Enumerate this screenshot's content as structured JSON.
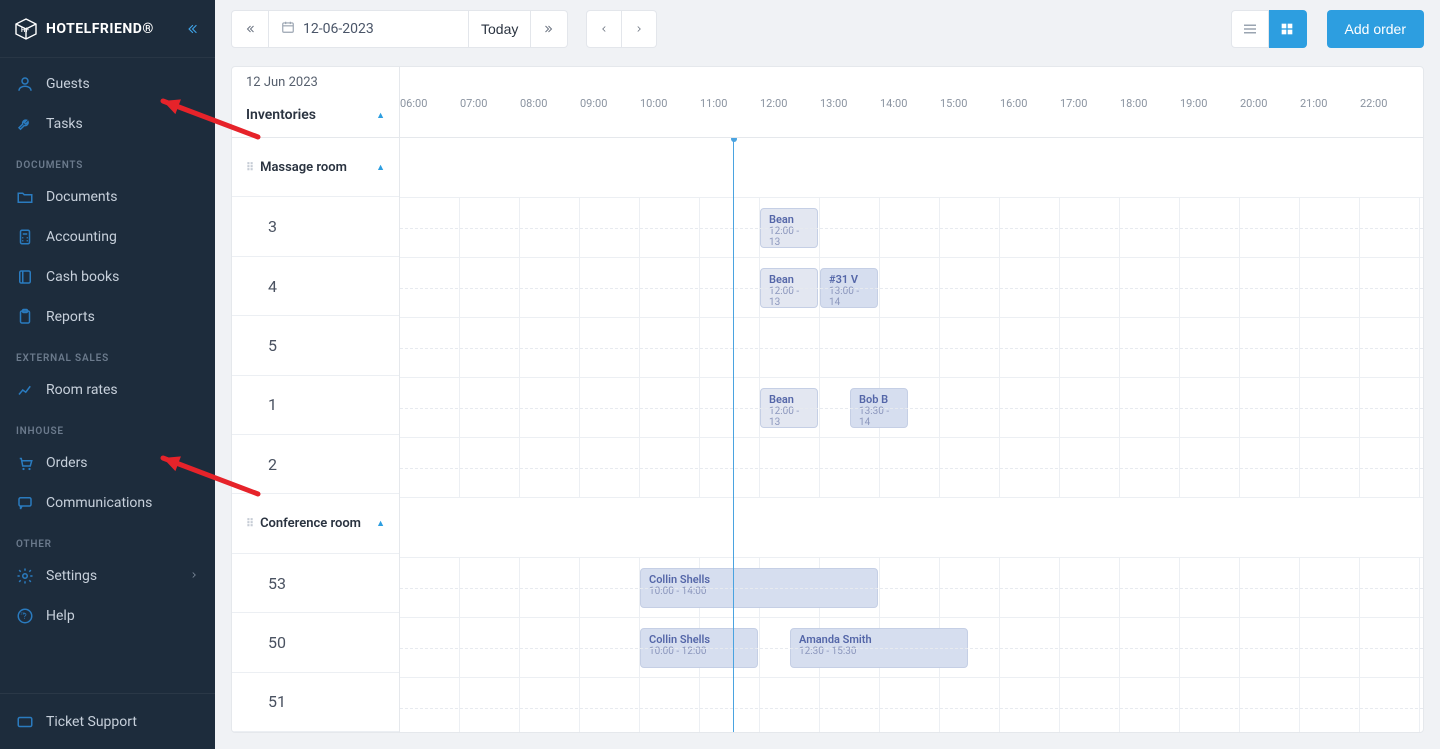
{
  "brand": {
    "name": "HOTELFRIEND",
    "trademark": "®"
  },
  "sidebar": {
    "items": [
      {
        "label": "Guests",
        "icon": "user-icon"
      },
      {
        "label": "Tasks",
        "icon": "wrench-icon"
      }
    ],
    "sections": [
      {
        "title": "DOCUMENTS",
        "items": [
          {
            "label": "Documents",
            "icon": "folder-icon"
          },
          {
            "label": "Accounting",
            "icon": "calculator-icon"
          },
          {
            "label": "Cash books",
            "icon": "book-icon"
          },
          {
            "label": "Reports",
            "icon": "clipboard-icon"
          }
        ]
      },
      {
        "title": "EXTERNAL SALES",
        "items": [
          {
            "label": "Room rates",
            "icon": "chart-icon"
          }
        ]
      },
      {
        "title": "INHOUSE",
        "items": [
          {
            "label": "Orders",
            "icon": "cart-icon"
          },
          {
            "label": "Communications",
            "icon": "chat-icon"
          }
        ]
      },
      {
        "title": "OTHER",
        "items": [
          {
            "label": "Settings",
            "icon": "gear-icon",
            "chevron": true
          },
          {
            "label": "Help",
            "icon": "help-icon"
          }
        ]
      }
    ],
    "footer": {
      "label": "Ticket Support",
      "icon": "ticket-icon"
    }
  },
  "toolbar": {
    "date": "12-06-2023",
    "today_label": "Today",
    "add_order_label": "Add order"
  },
  "scheduler": {
    "date_header": "12 Jun 2023",
    "inventories_label": "Inventories",
    "hours": [
      "06:00",
      "07:00",
      "08:00",
      "09:00",
      "10:00",
      "11:00",
      "12:00",
      "13:00",
      "14:00",
      "15:00",
      "16:00",
      "17:00",
      "18:00",
      "19:00",
      "20:00",
      "21:00",
      "22:00"
    ],
    "now_hour_fraction": 11.55,
    "groups": [
      {
        "name": "Massage room",
        "rows": [
          {
            "label": "3",
            "events": [
              {
                "name": "Bean",
                "time": "12:00 - 13",
                "start": 12,
                "end": 13,
                "light": true
              }
            ]
          },
          {
            "label": "4",
            "events": [
              {
                "name": "Bean",
                "time": "12:00 - 13",
                "start": 12,
                "end": 13,
                "light": true
              },
              {
                "name": "#31 V",
                "time": "13:00 - 14",
                "start": 13,
                "end": 14,
                "light": false
              }
            ]
          },
          {
            "label": "5",
            "events": []
          },
          {
            "label": "1",
            "events": [
              {
                "name": "Bean",
                "time": "12:00 - 13",
                "start": 12,
                "end": 13,
                "light": true
              },
              {
                "name": "Bob B",
                "time": "13:30 - 14",
                "start": 13.5,
                "end": 14.5,
                "light": false
              }
            ]
          },
          {
            "label": "2",
            "events": []
          }
        ]
      },
      {
        "name": "Conference room",
        "rows": [
          {
            "label": "53",
            "events": [
              {
                "name": "Collin Shells",
                "time": "10:00 - 14:00",
                "start": 10,
                "end": 14,
                "light": false
              }
            ]
          },
          {
            "label": "50",
            "events": [
              {
                "name": "Collin Shells",
                "time": "10:00 - 12:00",
                "start": 10,
                "end": 12,
                "light": false
              },
              {
                "name": "Amanda Smith",
                "time": "12:30 - 15:30",
                "start": 12.5,
                "end": 15.5,
                "light": false
              }
            ]
          },
          {
            "label": "51",
            "events": []
          }
        ]
      }
    ]
  }
}
